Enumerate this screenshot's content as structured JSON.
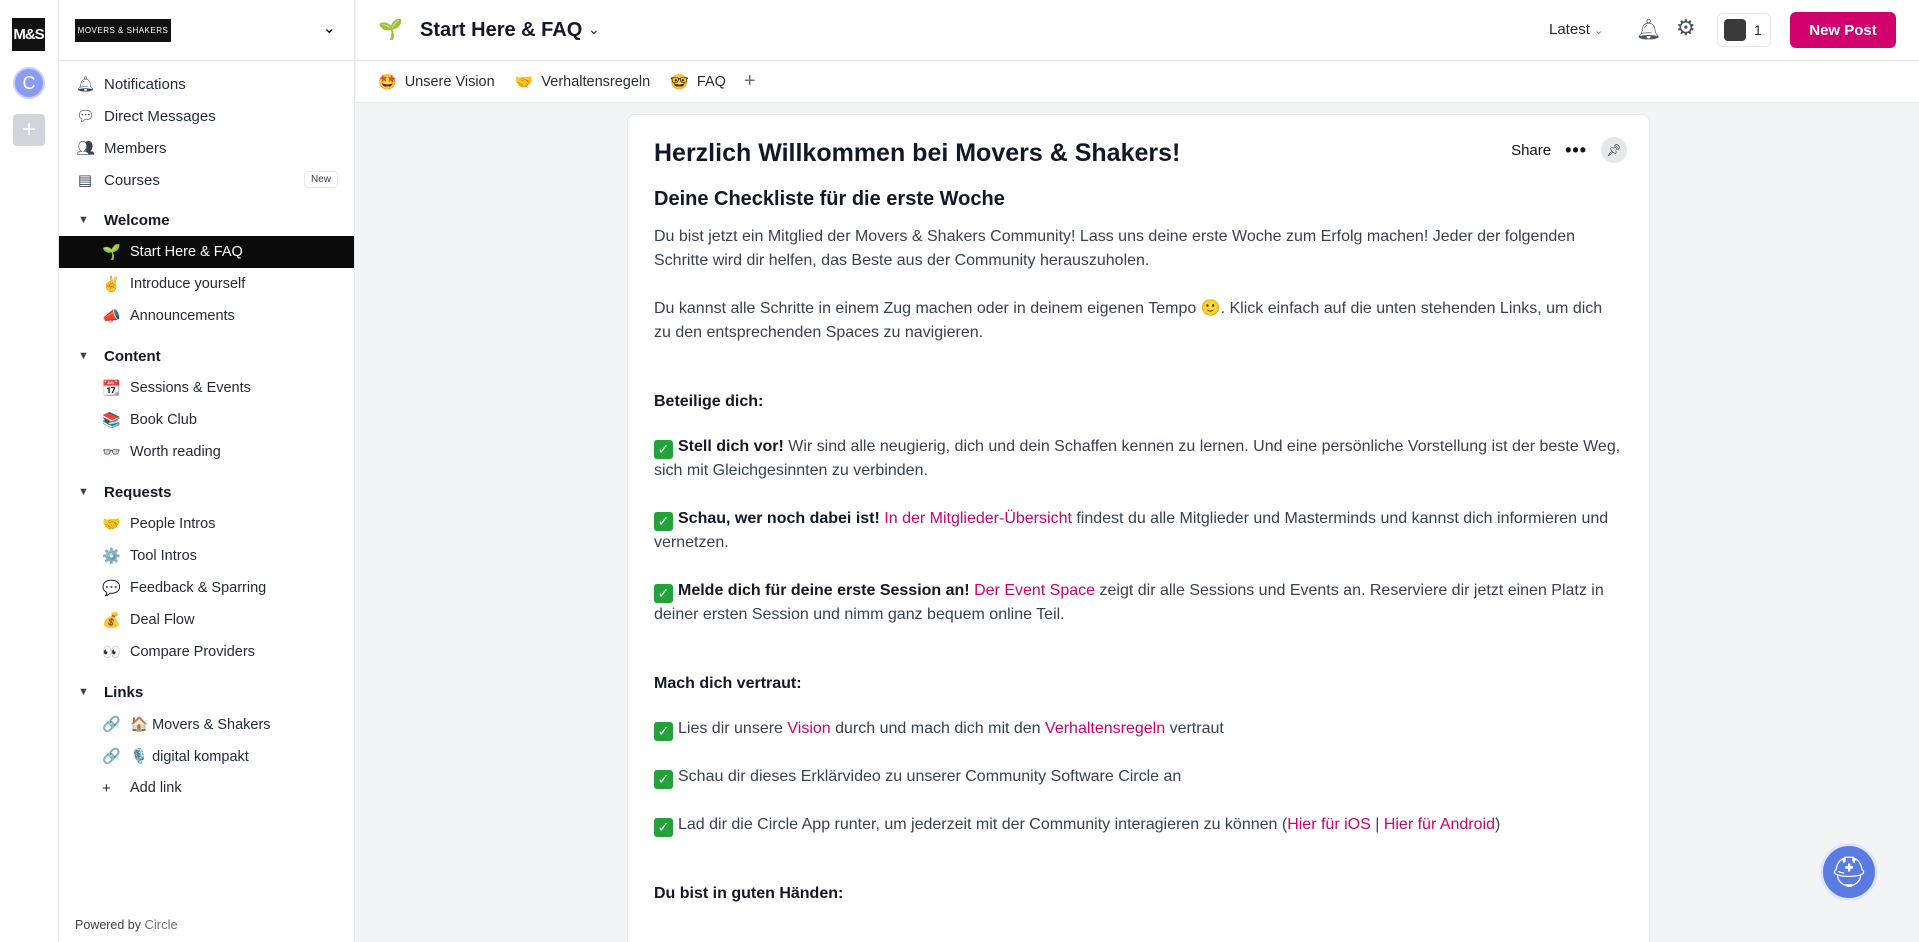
{
  "rail": {
    "logo": "M&S",
    "avatar_letter": "C",
    "add": "+"
  },
  "brand": {
    "logo_text": "MOVERS & SHAKERS"
  },
  "nav": [
    {
      "label": "Notifications",
      "icon": "bell-icon",
      "glyph": "🔔︎"
    },
    {
      "label": "Direct Messages",
      "icon": "chat-icon",
      "glyph": "💬︎"
    },
    {
      "label": "Members",
      "icon": "members-icon",
      "glyph": "👥︎"
    },
    {
      "label": "Courses",
      "icon": "book-icon",
      "glyph": "▤",
      "badge": "New"
    }
  ],
  "groups": [
    {
      "title": "Welcome",
      "items": [
        {
          "emoji": "🌱",
          "label": "Start Here & FAQ",
          "active": true
        },
        {
          "emoji": "✌️",
          "label": "Introduce yourself"
        },
        {
          "emoji": "📣",
          "label": "Announcements"
        }
      ]
    },
    {
      "title": "Content",
      "items": [
        {
          "emoji": "📆",
          "label": "Sessions & Events"
        },
        {
          "emoji": "📚",
          "label": "Book Club"
        },
        {
          "emoji": "👓",
          "label": "Worth reading"
        }
      ]
    },
    {
      "title": "Requests",
      "items": [
        {
          "emoji": "🤝",
          "label": "People Intros"
        },
        {
          "emoji": "⚙️",
          "label": "Tool Intros"
        },
        {
          "emoji": "💬",
          "label": "Feedback & Sparring"
        },
        {
          "emoji": "💰",
          "label": "Deal Flow"
        },
        {
          "emoji": "👀",
          "label": "Compare Providers"
        }
      ]
    },
    {
      "title": "Links",
      "items": [
        {
          "emoji": "🔗",
          "label": "🏠 Movers & Shakers"
        },
        {
          "emoji": "🔗",
          "label": "🎙️ digital kompakt"
        },
        {
          "emoji": "+",
          "label": "Add link"
        }
      ]
    }
  ],
  "footer": {
    "powered_by": "Powered by",
    "brand": "Circle"
  },
  "header": {
    "emoji": "🌱",
    "title": "Start Here & FAQ",
    "sort": "Latest",
    "user_count": "1",
    "new_post": "New Post"
  },
  "tabs": [
    {
      "emoji": "🤩",
      "label": "Unsere Vision"
    },
    {
      "emoji": "🤝",
      "label": "Verhaltensregeln"
    },
    {
      "emoji": "🤓",
      "label": "FAQ"
    }
  ],
  "post": {
    "title": "Herzlich Willkommen bei Movers & Shakers!",
    "share": "Share",
    "subtitle": "Deine Checkliste für die erste Woche",
    "intro1": "Du bist jetzt ein Mitglied der Movers & Shakers Community! Lass uns deine erste Woche zum Erfolg machen! Jeder der folgenden Schritte wird dir helfen, das Beste aus der Community herauszuholen.",
    "intro2": "Du kannst alle Schritte in einem Zug machen oder in deinem eigenen Tempo 🙂. Klick einfach auf die unten stehenden Links, um dich zu den entsprechenden Spaces zu navigieren.",
    "section1": "Beteilige dich:",
    "c1_bold": "Stell dich vor!",
    "c1_text": " Wir sind alle neugierig, dich und dein Schaffen kennen zu lernen. Und eine persönliche Vorstellung ist der beste Weg, sich mit Gleichgesinnten zu verbinden.",
    "c2_bold": "Schau, wer noch dabei ist!",
    "c2_link": "In der Mitglieder-Übersicht",
    "c2_text": " findest du alle Mitglieder und Masterminds und kannst dich informieren und vernetzen.",
    "c3_bold": "Melde dich für deine erste Session an!",
    "c3_link": "Der Event Space",
    "c3_text": " zeigt dir alle Sessions und Events an. Reserviere dir jetzt einen Platz in deiner ersten Session und nimm ganz bequem online Teil.",
    "section2": "Mach dich vertraut:",
    "c4_a": "Lies dir unsere ",
    "c4_link1": "Vision",
    "c4_b": " durch und mach dich mit den ",
    "c4_link2": "Verhaltensregeln",
    "c4_c": " vertraut",
    "c5": "Schau dir dieses Erklärvideo zu unserer Community Software Circle an",
    "c6_a": "Lad dir die Circle App runter, um jederzeit mit der Community interagieren zu können (",
    "c6_link1": "Hier für iOS",
    "c6_sep": " | ",
    "c6_link2": "Hier für Android",
    "c6_b": ")",
    "section3": "Du bist in guten Händen:"
  }
}
